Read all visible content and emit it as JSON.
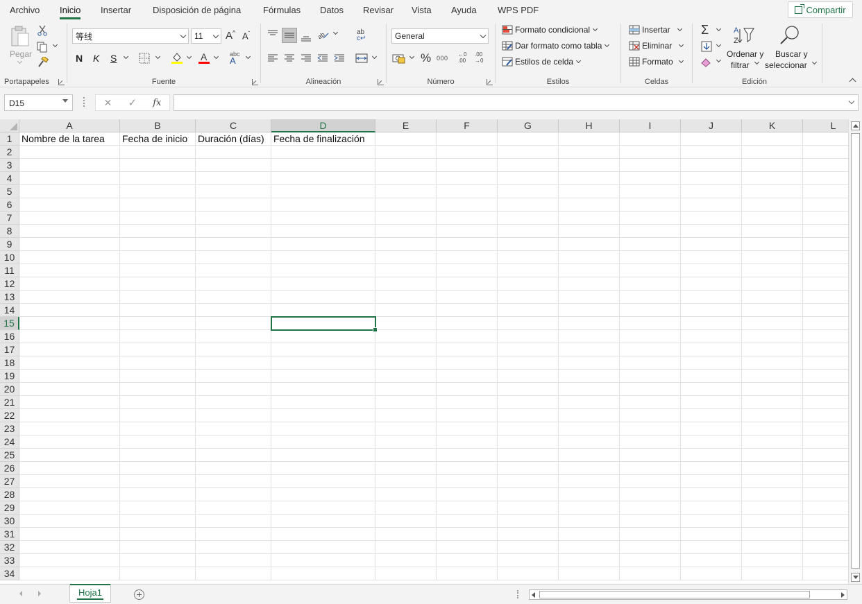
{
  "tabs": [
    "Archivo",
    "Inicio",
    "Insertar",
    "Disposición de página",
    "Fórmulas",
    "Datos",
    "Revisar",
    "Vista",
    "Ayuda",
    "WPS PDF"
  ],
  "active_tab": "Inicio",
  "share_label": "Compartir",
  "ribbon": {
    "clipboard": {
      "label": "Portapapeles",
      "paste": "Pegar"
    },
    "font": {
      "label": "Fuente",
      "name": "等线",
      "size": "11",
      "bold": "N",
      "italic": "K",
      "underline": "S"
    },
    "alignment": {
      "label": "Alineación"
    },
    "number": {
      "label": "Número",
      "format": "General",
      "percent": "%",
      "thousands": "000"
    },
    "styles": {
      "label": "Estilos",
      "conditional": "Formato condicional",
      "as_table": "Dar formato como tabla",
      "cell_styles": "Estilos de celda"
    },
    "cells": {
      "label": "Celdas",
      "insert": "Insertar",
      "delete": "Eliminar",
      "format": "Formato"
    },
    "editing": {
      "label": "Edición",
      "sort_line1": "Ordenar y",
      "sort_line2": "filtrar",
      "find_line1": "Buscar y",
      "find_line2": "seleccionar",
      "sigma": "Σ"
    }
  },
  "formula_bar": {
    "name_box": "D15",
    "cancel": "✕",
    "enter": "✓",
    "fx": "fx",
    "content": ""
  },
  "grid": {
    "columns": [
      "A",
      "B",
      "C",
      "D",
      "E",
      "F",
      "G",
      "H",
      "I",
      "J",
      "K",
      "L"
    ],
    "rows": [
      "1",
      "2",
      "3",
      "4",
      "5",
      "6",
      "7",
      "8",
      "9",
      "10",
      "11",
      "12",
      "13",
      "14",
      "15",
      "16",
      "17",
      "18",
      "19",
      "20",
      "21",
      "22",
      "23",
      "24",
      "25",
      "26",
      "27",
      "28",
      "29",
      "30",
      "31",
      "32",
      "33",
      "34"
    ],
    "row1": [
      "Nombre de la tarea",
      "Fecha de inicio",
      "Duración (días)",
      "Fecha de finalización"
    ],
    "selected_cell": "D15",
    "selected_col": "D",
    "selected_row": "15"
  },
  "sheets": [
    "Hoja1"
  ],
  "colors": {
    "accent": "#217346",
    "font_highlight": "#ffff00",
    "font_color": "#ff0000"
  }
}
